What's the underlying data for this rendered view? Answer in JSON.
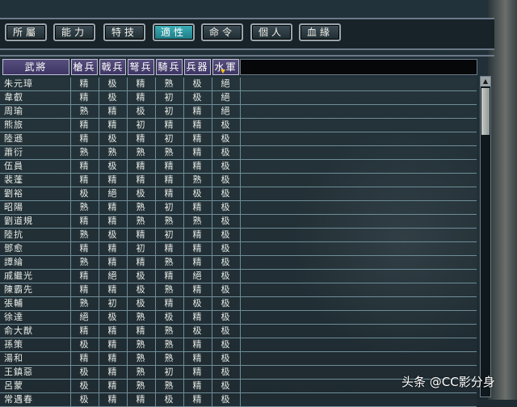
{
  "tabs": [
    {
      "label": "所屬",
      "active": false
    },
    {
      "label": "能力",
      "active": false
    },
    {
      "label": "特技",
      "active": false
    },
    {
      "label": "適性",
      "active": true
    },
    {
      "label": "命令",
      "active": false
    },
    {
      "label": "個人",
      "active": false
    },
    {
      "label": "血緣",
      "active": false
    }
  ],
  "columns": [
    "武將",
    "槍兵",
    "戟兵",
    "弩兵",
    "騎兵",
    "兵器",
    "水軍"
  ],
  "sorted_column": "水軍",
  "rows": [
    {
      "name": "朱元璋",
      "v": [
        "精",
        "极",
        "精",
        "熟",
        "极",
        "絕"
      ]
    },
    {
      "name": "韋叡",
      "v": [
        "精",
        "极",
        "精",
        "初",
        "极",
        "絕"
      ]
    },
    {
      "name": "周瑜",
      "v": [
        "熟",
        "精",
        "极",
        "初",
        "精",
        "絕"
      ]
    },
    {
      "name": "熊旅",
      "v": [
        "精",
        "精",
        "初",
        "精",
        "精",
        "极"
      ]
    },
    {
      "name": "陸遜",
      "v": [
        "精",
        "极",
        "精",
        "初",
        "精",
        "极"
      ]
    },
    {
      "name": "蕭衍",
      "v": [
        "熟",
        "熟",
        "熟",
        "熟",
        "精",
        "极"
      ]
    },
    {
      "name": "伍員",
      "v": [
        "精",
        "极",
        "精",
        "精",
        "精",
        "极"
      ]
    },
    {
      "name": "裴蓬",
      "v": [
        "精",
        "精",
        "精",
        "精",
        "熟",
        "极"
      ]
    },
    {
      "name": "劉裕",
      "v": [
        "极",
        "絕",
        "极",
        "精",
        "极",
        "极"
      ]
    },
    {
      "name": "昭陽",
      "v": [
        "熟",
        "精",
        "熟",
        "初",
        "精",
        "极"
      ]
    },
    {
      "name": "劉道規",
      "v": [
        "精",
        "精",
        "熟",
        "熟",
        "熟",
        "极"
      ]
    },
    {
      "name": "陸抗",
      "v": [
        "熟",
        "极",
        "精",
        "初",
        "精",
        "极"
      ]
    },
    {
      "name": "鄧愈",
      "v": [
        "精",
        "精",
        "初",
        "精",
        "精",
        "极"
      ]
    },
    {
      "name": "譚綸",
      "v": [
        "熟",
        "精",
        "精",
        "熟",
        "精",
        "极"
      ]
    },
    {
      "name": "戚繼光",
      "v": [
        "精",
        "絕",
        "极",
        "精",
        "絕",
        "极"
      ]
    },
    {
      "name": "陳霸先",
      "v": [
        "精",
        "精",
        "极",
        "熟",
        "精",
        "极"
      ]
    },
    {
      "name": "張輔",
      "v": [
        "熟",
        "初",
        "极",
        "精",
        "极",
        "极"
      ]
    },
    {
      "name": "徐達",
      "v": [
        "絕",
        "极",
        "熟",
        "极",
        "精",
        "极"
      ]
    },
    {
      "name": "俞大猷",
      "v": [
        "精",
        "精",
        "精",
        "熟",
        "极",
        "极"
      ]
    },
    {
      "name": "孫策",
      "v": [
        "极",
        "精",
        "熟",
        "熟",
        "精",
        "极"
      ]
    },
    {
      "name": "湯和",
      "v": [
        "精",
        "精",
        "熟",
        "熟",
        "精",
        "极"
      ]
    },
    {
      "name": "王鎮惡",
      "v": [
        "极",
        "精",
        "熟",
        "初",
        "精",
        "极"
      ]
    },
    {
      "name": "呂蒙",
      "v": [
        "极",
        "精",
        "熟",
        "熟",
        "精",
        "极"
      ]
    },
    {
      "name": "常遇春",
      "v": [
        "极",
        "精",
        "精",
        "极",
        "精",
        "极"
      ]
    }
  ],
  "watermark": "头条 @CC影分身",
  "colors": {
    "active_tab": "#2f9aa3",
    "header": "#4a4270",
    "grid": "#6f8d99"
  }
}
